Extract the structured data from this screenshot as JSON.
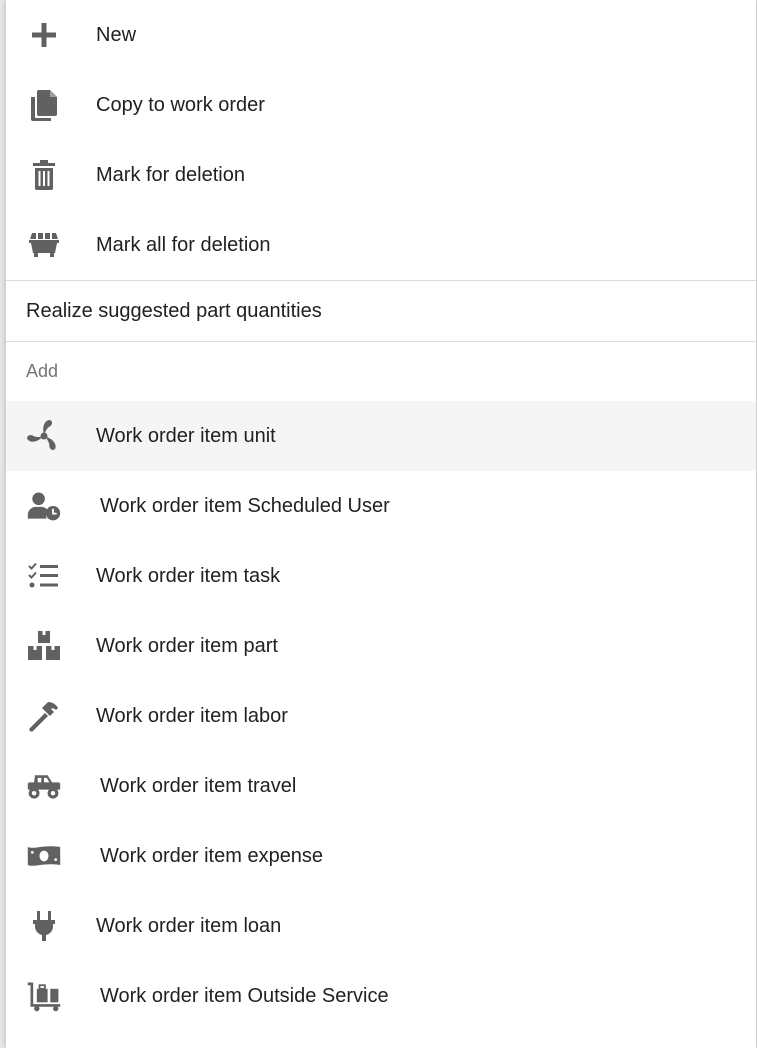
{
  "menu": {
    "top_items": [
      {
        "label": "New",
        "icon": "plus-icon"
      },
      {
        "label": "Copy to work order",
        "icon": "copy-icon"
      },
      {
        "label": "Mark for deletion",
        "icon": "trash-icon"
      },
      {
        "label": "Mark all for deletion",
        "icon": "dumpster-icon"
      }
    ],
    "realize_label": "Realize suggested part quantities",
    "add_header": "Add",
    "add_items": [
      {
        "label": "Work order item unit",
        "icon": "fan-icon"
      },
      {
        "label": "Work order item Scheduled User",
        "icon": "user-clock-icon"
      },
      {
        "label": "Work order item task",
        "icon": "checklist-icon"
      },
      {
        "label": "Work order item part",
        "icon": "boxes-icon"
      },
      {
        "label": "Work order item labor",
        "icon": "hammer-icon"
      },
      {
        "label": "Work order item travel",
        "icon": "truck-icon"
      },
      {
        "label": "Work order item expense",
        "icon": "money-icon"
      },
      {
        "label": "Work order item loan",
        "icon": "plug-icon"
      },
      {
        "label": "Work order item Outside Service",
        "icon": "dolly-icon"
      }
    ]
  },
  "colors": {
    "icon": "#616161",
    "text": "#212121",
    "header_text": "#757575",
    "hover_bg": "#f5f5f5",
    "divider": "#dcdcdc"
  }
}
